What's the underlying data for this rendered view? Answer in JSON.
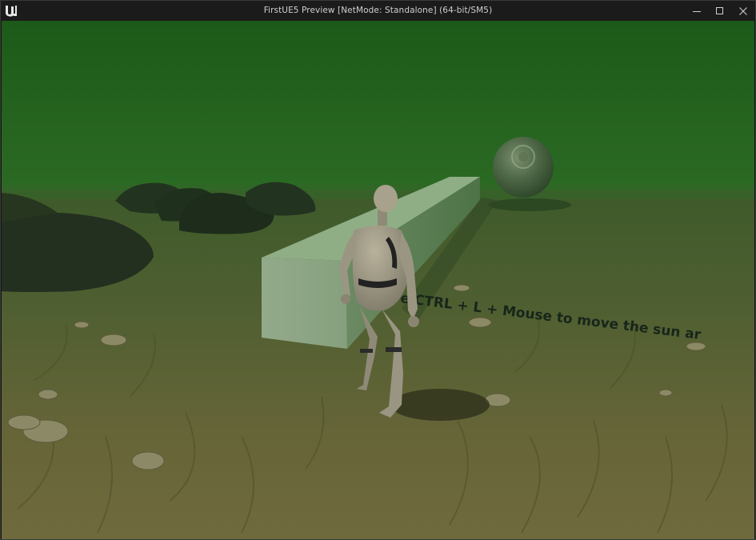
{
  "window": {
    "title": "FirstUE5 Preview [NetMode: Standalone]  (64-bit/SM5)",
    "logo_icon": "unreal-engine-logo-icon",
    "controls": {
      "minimize_icon": "minimize-icon",
      "maximize_icon": "maximize-icon",
      "close_icon": "close-icon"
    }
  },
  "scene": {
    "floor_text": "e CTRL + L + Mouse to move the sun ar",
    "sky_color": "#1f5e1c",
    "fog_color": "#2c6a25",
    "floor_near_color": "#6e6a3c",
    "floor_far_color": "#40592b"
  }
}
